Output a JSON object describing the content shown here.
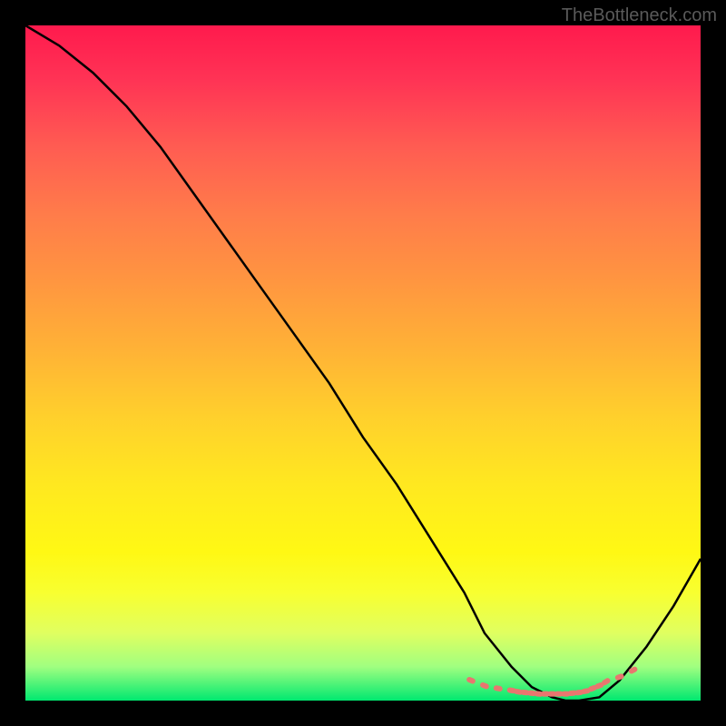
{
  "watermark": "TheBottleneck.com",
  "chart_data": {
    "type": "line",
    "title": "",
    "xlabel": "",
    "ylabel": "",
    "xlim": [
      0,
      100
    ],
    "ylim": [
      0,
      100
    ],
    "series": [
      {
        "name": "bottleneck-curve",
        "x": [
          0,
          5,
          10,
          15,
          20,
          25,
          30,
          35,
          40,
          45,
          50,
          55,
          60,
          65,
          68,
          72,
          75,
          78,
          80,
          82,
          85,
          88,
          92,
          96,
          100
        ],
        "y": [
          100,
          97,
          93,
          88,
          82,
          75,
          68,
          61,
          54,
          47,
          39,
          32,
          24,
          16,
          10,
          5,
          2,
          0.5,
          0,
          0,
          0.5,
          3,
          8,
          14,
          21
        ]
      },
      {
        "name": "recommended-range-markers",
        "x": [
          66,
          68,
          70,
          72,
          73,
          74,
          75,
          76,
          77,
          78,
          79,
          80,
          81,
          82,
          83,
          84,
          85,
          86,
          88,
          90
        ],
        "y": [
          3,
          2.2,
          1.8,
          1.5,
          1.3,
          1.2,
          1.1,
          1.0,
          1.0,
          1.0,
          1.0,
          1.0,
          1.1,
          1.2,
          1.4,
          1.8,
          2.2,
          2.8,
          3.5,
          4.5
        ]
      }
    ],
    "gradient_colors": {
      "top": "#ff1a4d",
      "bottom": "#00e870"
    },
    "marker_color": "#e8766f"
  }
}
